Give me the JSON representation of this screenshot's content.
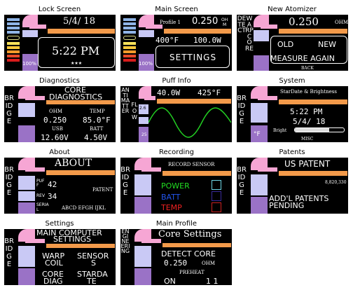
{
  "panels": [
    {
      "caption": "Lock Screen",
      "date": "5/4/ 18",
      "time": "5:22 PM",
      "stars": "★★★",
      "battery": "100%"
    },
    {
      "caption": "Main Screen",
      "profile": "Profile 1",
      "ohms": "0.250",
      "ohms_unit_top": "OH",
      "ohms_unit_bot": "M",
      "temp": "400°F",
      "watts": "100.0W",
      "settings": "SETTINGS",
      "battery": "100%"
    },
    {
      "caption": "New Atomizer",
      "side_a": "DETECT",
      "side_b": "WARP CORE",
      "ohms": "0.250",
      "ohms_unit": "OHM",
      "old": "OLD",
      "new": "NEW",
      "measure": "MEASURE AGAIN",
      "back": "BACK"
    },
    {
      "caption": "Diagnostics",
      "side": "BRIDGE",
      "title1": "CORE",
      "title2": "DIAGNOSTICS",
      "l_ohm": "OHM",
      "l_temp": "TEMP",
      "v_ohm": "0.250",
      "v_temp": "85.0°F",
      "l_usb": "USB",
      "l_batt": "BATT",
      "v_usb": "12.60V",
      "v_batt": "4.50V"
    },
    {
      "caption": "Puff Info",
      "side_a": "ANTIMATTER",
      "side_b": "FLOW",
      "watts": "40.0W",
      "temp": "425°F",
      "tick_top": "2.6",
      "tick_bot": "25"
    },
    {
      "caption": "System",
      "side": "BRIDGE",
      "title": "StarDate & Brightness",
      "time": "5:22 PM",
      "date": "5/4/ 18",
      "bright": "Bright",
      "misc": "MISC",
      "unit": "°F",
      "brightness_level": 0.7
    },
    {
      "caption": "About",
      "side": "BRIDGE",
      "title": "ABOUT",
      "puff_l": "PUF F",
      "puff_v": "42",
      "rev_l": "REV",
      "rev_v": "34",
      "patent": "PATENT",
      "serial_l": "SERIA L",
      "serial_v": "ABCD EFGH IJKL"
    },
    {
      "caption": "Recording",
      "side": "BRIDGE",
      "title": "RECORD SENSOR",
      "items": [
        {
          "label": "POWER",
          "color": "#22dd22"
        },
        {
          "label": "BATT",
          "color": "#2255ee"
        },
        {
          "label": "TEMP",
          "color": "#ee2222"
        }
      ],
      "box_colors": [
        "#6fd6e6",
        "#3a2a99",
        "#cc2222"
      ]
    },
    {
      "caption": "Patents",
      "side": "BRIDGE",
      "title": "US PATENT",
      "number": "8,820,330",
      "pend1": "ADD'L PATENTS",
      "pend2": "PENDING"
    },
    {
      "caption": "Settings",
      "side": "BRIDGE",
      "title1": "MAIN COMPUTER",
      "title2": "SETTINGS",
      "warp1": "WARP",
      "warp2": "COIL",
      "sensor1": "SENSOR",
      "sensor2": "S",
      "core1": "CORE",
      "core2": "DIAG",
      "star1": "STARDA",
      "star2": "TE"
    },
    {
      "caption": "Main Profile",
      "side": "ENGINEERING",
      "title": "Core Settings",
      "detect": "DETECT CORE",
      "ohms": "0.250",
      "ohms_unit": "OHM",
      "preheat": "PREHEAT",
      "on": "ON",
      "val": "1 1"
    }
  ]
}
